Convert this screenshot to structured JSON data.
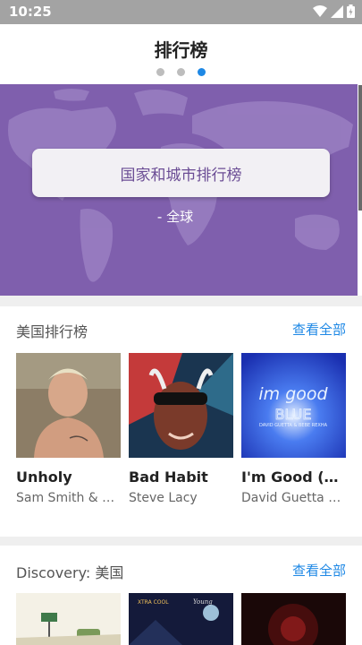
{
  "status_bar": {
    "time": "10:25"
  },
  "header": {
    "title": "排行榜",
    "pager": {
      "count": 3,
      "active": 3
    }
  },
  "banner": {
    "button_label": "国家和城市排行榜",
    "subtitle": "- 全球"
  },
  "sections": [
    {
      "title": "美国排行榜",
      "link": "查看全部",
      "items": [
        {
          "title": "Unholy",
          "artist": "Sam Smith & Kim Petras"
        },
        {
          "title": "Bad Habit",
          "artist": "Steve Lacy"
        },
        {
          "title": "I'm Good (Blue)",
          "artist": "David Guetta & Bebe Rexha"
        }
      ]
    },
    {
      "title": "Discovery: 美国",
      "link": "查看全部"
    }
  ],
  "colors": {
    "accent": "#1e88e5",
    "banner": "#7f5fad",
    "status_bar": "#a3a3a3"
  }
}
